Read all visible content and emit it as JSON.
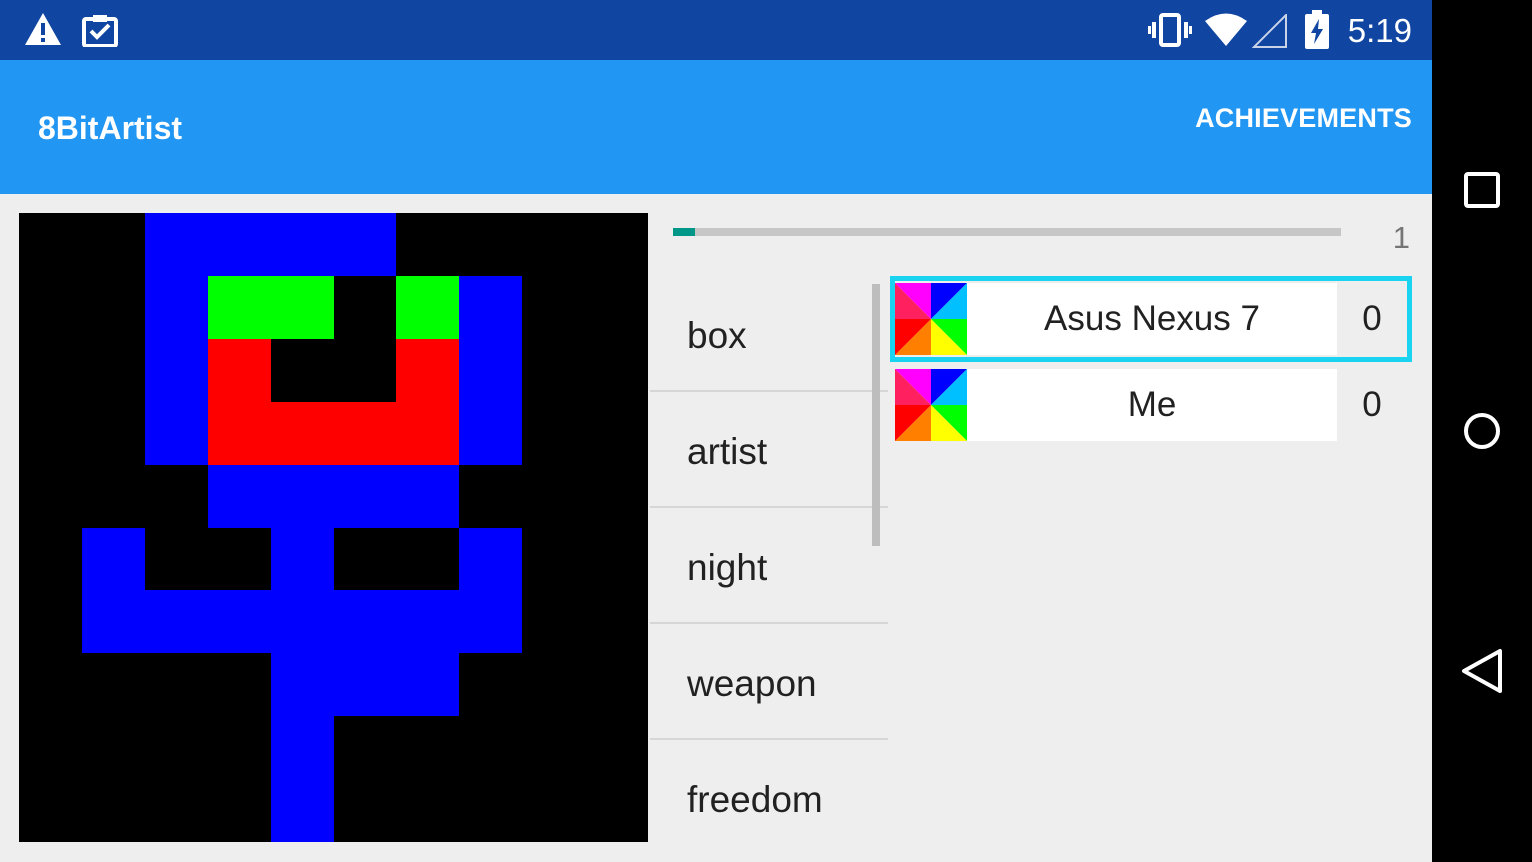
{
  "status_bar": {
    "time": "5:19",
    "left_icons": [
      "warning-icon",
      "clipboard-check-icon"
    ],
    "right_icons": [
      "vibrate-icon",
      "wifi-icon",
      "cell-signal-icon",
      "battery-charging-icon"
    ]
  },
  "app_bar": {
    "title": "8BitArtist",
    "action_label": "ACHIEVEMENTS",
    "color": "#2196f3"
  },
  "canvas": {
    "grid_size": "10x10",
    "background": "#000000",
    "palette": {
      "b": "#0000ff",
      "g": "#00ff00",
      "r": "#ff0000",
      "k": "#000000"
    },
    "rows": [
      "..bbbb....",
      "..bggkgb..",
      "..brkkrb..",
      "..brrrrb..",
      "...bbbb...",
      ".b..b..b..",
      ".bbbbbbb..",
      "....bbb...",
      "....b.....",
      "....b....."
    ]
  },
  "progress": {
    "fraction": 0.033,
    "count": "1",
    "track_color": "#c6c6c6",
    "fill_color": "#009688"
  },
  "words": [
    {
      "label": "box"
    },
    {
      "label": "artist"
    },
    {
      "label": "night"
    },
    {
      "label": "weapon"
    },
    {
      "label": "freedom"
    }
  ],
  "players": [
    {
      "name": "Asus Nexus 7",
      "score": "0",
      "selected": true,
      "avatar": "rainbow-pinwheel-icon"
    },
    {
      "name": "Me",
      "score": "0",
      "selected": false,
      "avatar": "rainbow-pinwheel-icon"
    }
  ],
  "nav_bar": {
    "buttons": [
      "recents-square-icon",
      "home-circle-icon",
      "back-triangle-icon"
    ]
  }
}
